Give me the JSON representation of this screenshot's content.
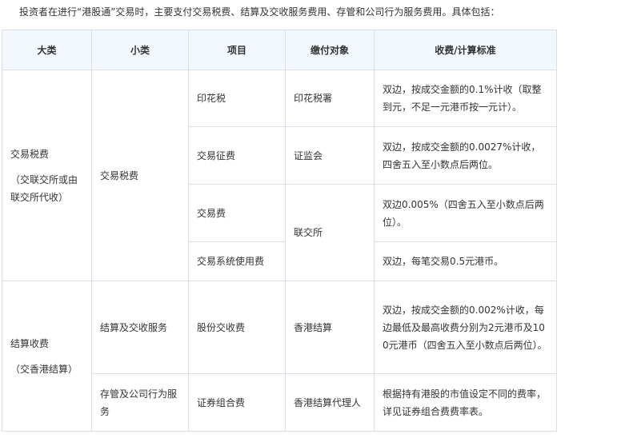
{
  "intro": "投资者在进行“港股通”交易时，主要支付交易税费、结算及交收服务费用、存管和公司行为服务费用。具体包括：",
  "headers": {
    "category": "大类",
    "subcategory": "小类",
    "item": "项目",
    "payee": "缴付对象",
    "standard": "收费/计算标准"
  },
  "groups": {
    "trading": {
      "category": "交易税费",
      "category_note": "（交联交所或由联交所代收）",
      "subcategory": "交易税费"
    },
    "settlement": {
      "category": "结算收费",
      "category_note": "（交香港结算）"
    }
  },
  "rows": [
    {
      "item": "印花税",
      "payee": "印花税署",
      "standard": "双边，按成交金额的0.1%计收（取整到元，不足一元港币按一元计）。"
    },
    {
      "item": "交易征费",
      "payee": "证监会",
      "standard": "双边，按成交金额的0.0027%计收，四舍五入至小数点后两位。"
    },
    {
      "item": "交易费",
      "payee": "联交所",
      "standard": "双边0.005%（四舍五入至小数点后两位）。"
    },
    {
      "item": "交易系统使用费",
      "standard": "双边，每笔交易0.5元港币。"
    },
    {
      "subcategory": "结算及交收服务",
      "item": "股份交收费",
      "payee": "香港结算",
      "standard": "双边，按成交金额的0.002%计收，每边最低及最高收费分别为2元港币及100元港币（四舍五入至小数点后两位）。"
    },
    {
      "subcategory": "存管及公司行为服务",
      "item": "证券组合费",
      "payee": "香港结算代理人",
      "standard": "根据持有港股的市值设定不同的费率，详见证券组合费费率表。"
    }
  ]
}
